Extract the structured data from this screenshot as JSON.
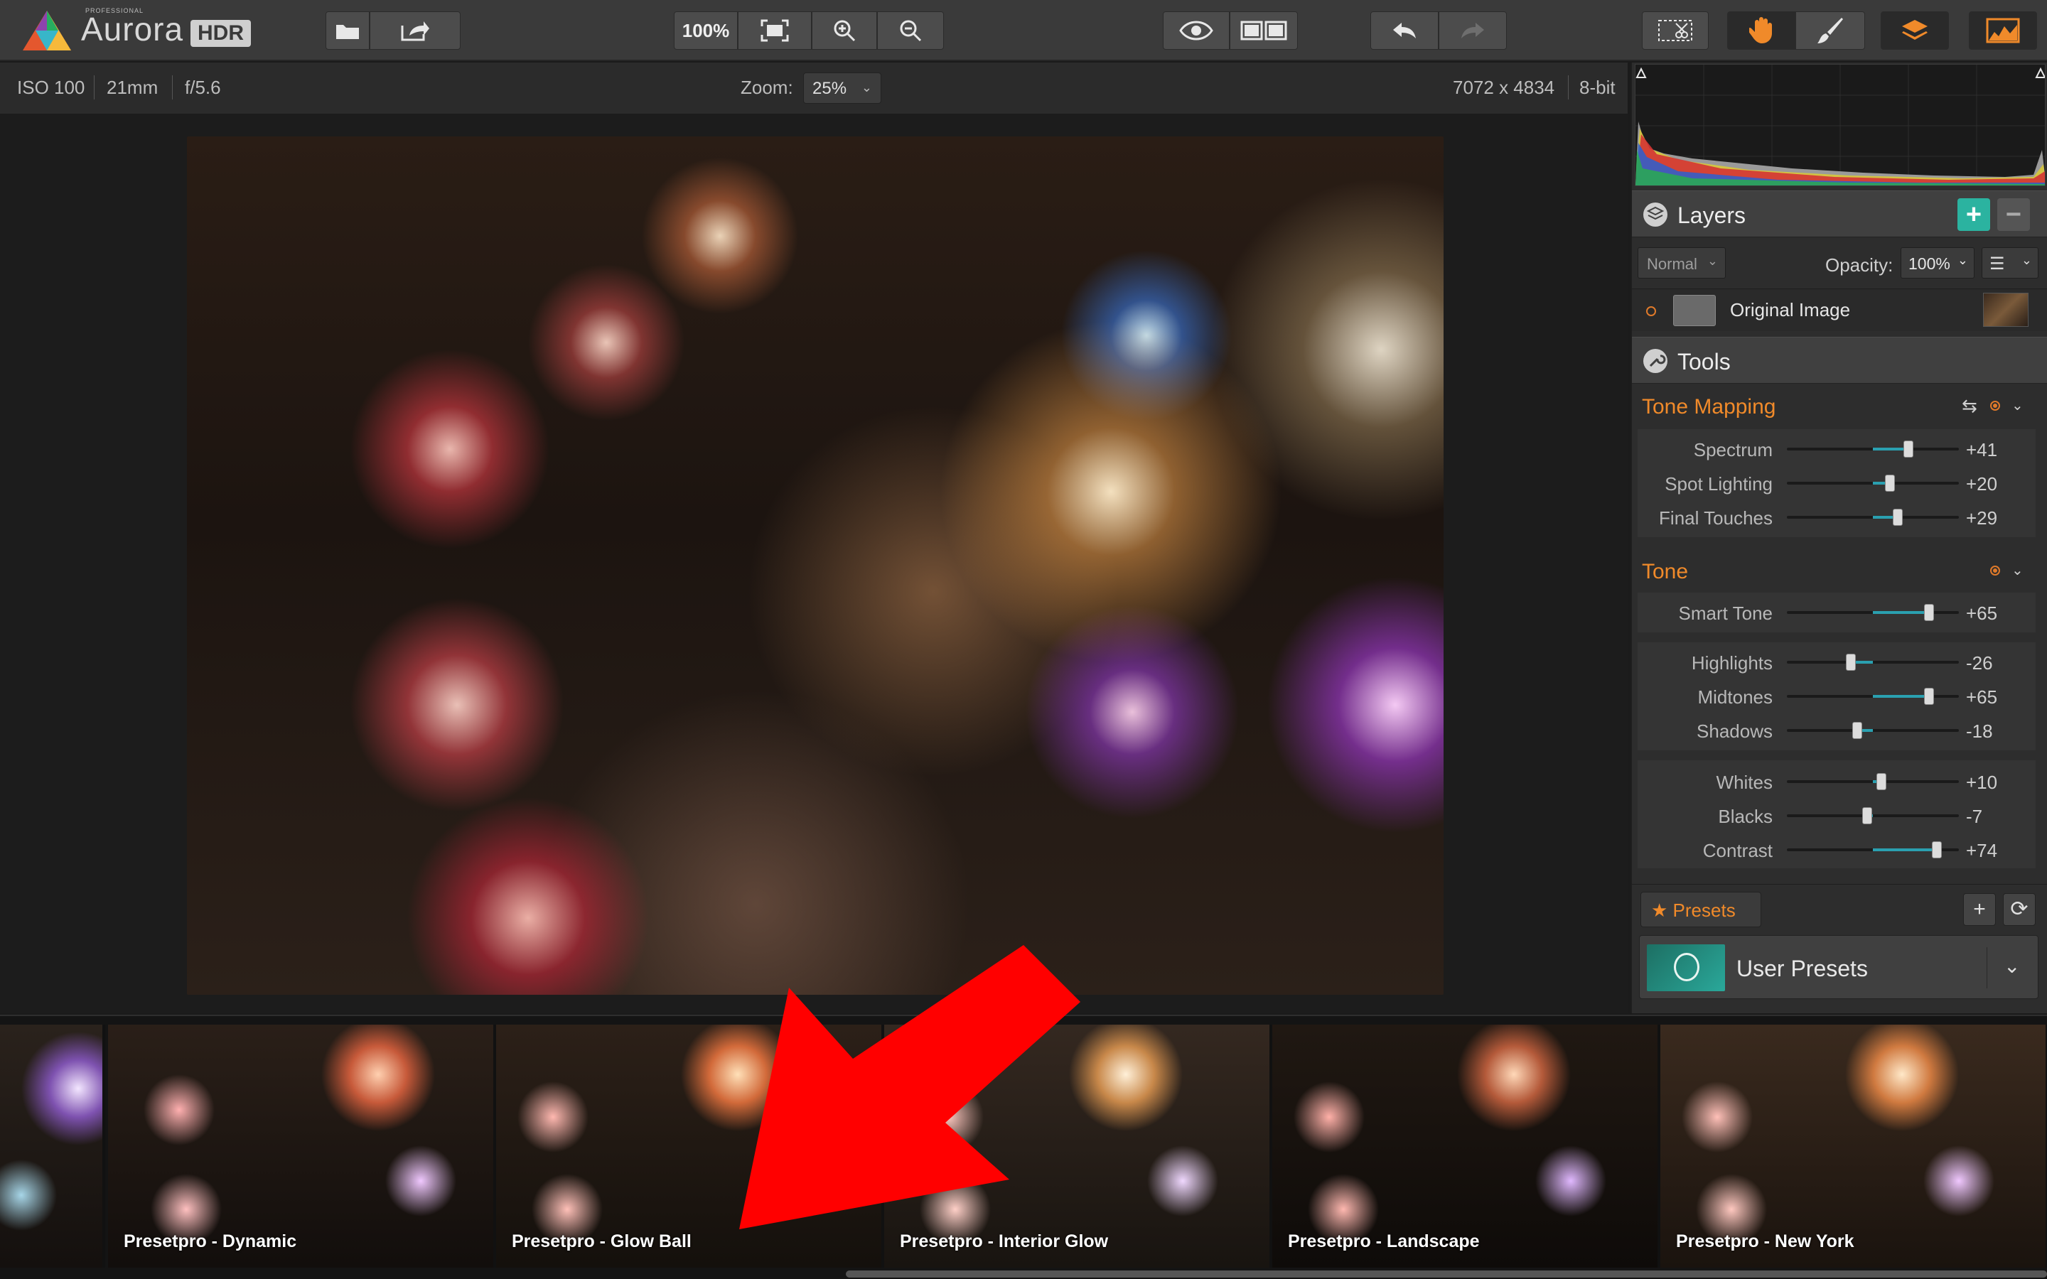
{
  "app": {
    "brand": "Aurora",
    "brand_small": "PROFESSIONAL",
    "brand_badge": "HDR"
  },
  "toolbar": {
    "zoom_100_label": "100%",
    "icons": [
      "open-folder-icon",
      "share-icon",
      "fit-screen-icon",
      "zoom-in-icon",
      "zoom-out-icon",
      "preview-eye-icon",
      "compare-icon",
      "undo-icon",
      "redo-icon",
      "crop-cut-icon",
      "hand-icon",
      "brush-icon",
      "layers-icon",
      "histogram-icon"
    ]
  },
  "info": {
    "iso": "ISO 100",
    "focal": "21mm",
    "aperture": "f/5.6",
    "zoom_label": "Zoom:",
    "zoom_value": "25%",
    "dimensions": "7072 x 4834",
    "bit_depth": "8-bit"
  },
  "layers": {
    "title": "Layers",
    "blend_mode": "Normal",
    "opacity_label": "Opacity:",
    "opacity_value": "100%",
    "layer_name": "Original Image"
  },
  "tools": {
    "title": "Tools",
    "tone_mapping": {
      "title": "Tone Mapping",
      "sliders": [
        {
          "label": "Spectrum",
          "value": "+41",
          "num": 41
        },
        {
          "label": "Spot Lighting",
          "value": "+20",
          "num": 20
        },
        {
          "label": "Final Touches",
          "value": "+29",
          "num": 29
        }
      ]
    },
    "tone": {
      "title": "Tone",
      "smart_tone": {
        "label": "Smart Tone",
        "value": "+65",
        "num": 65
      },
      "sliders_a": [
        {
          "label": "Highlights",
          "value": "-26",
          "num": -26
        },
        {
          "label": "Midtones",
          "value": "+65",
          "num": 65
        },
        {
          "label": "Shadows",
          "value": "-18",
          "num": -18
        }
      ],
      "sliders_b": [
        {
          "label": "Whites",
          "value": "+10",
          "num": 10
        },
        {
          "label": "Blacks",
          "value": "-7",
          "num": -7
        },
        {
          "label": "Contrast",
          "value": "+74",
          "num": 74
        }
      ]
    }
  },
  "presets": {
    "button_label": "Presets",
    "category": "User Presets"
  },
  "filmstrip": {
    "items": [
      {
        "label": "Presetpro - Dynamic"
      },
      {
        "label": "Presetpro - Glow Ball"
      },
      {
        "label": "Presetpro - Interior Glow"
      },
      {
        "label": "Presetpro - Landscape"
      },
      {
        "label": "Presetpro - New York"
      }
    ]
  },
  "colors": {
    "accent_orange": "#f08a2a",
    "slider_fill": "#2aa0b0",
    "add_green": "#2bb3a0",
    "arrow_red": "#ff0000"
  }
}
